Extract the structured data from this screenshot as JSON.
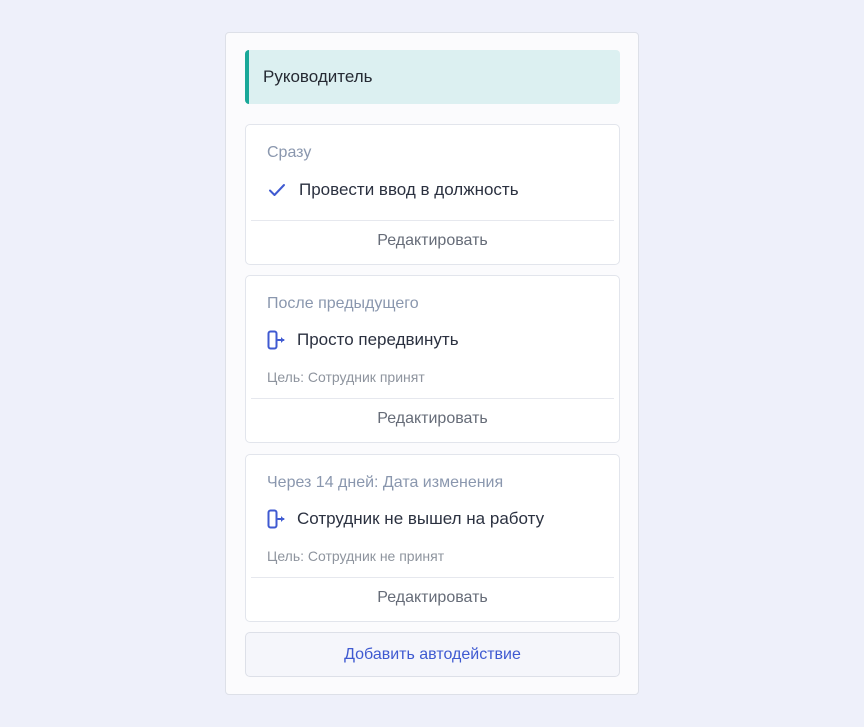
{
  "header": {
    "title": "Руководитель"
  },
  "cards": [
    {
      "trigger": "Сразу",
      "action_label": "Провести ввод в должность",
      "action_icon": "check-icon",
      "goal": "",
      "edit_label": "Редактировать"
    },
    {
      "trigger": "После предыдущего",
      "action_label": "Просто передвинуть",
      "action_icon": "move-to-stage-icon",
      "goal": "Цель: Сотрудник принят",
      "edit_label": "Редактировать"
    },
    {
      "trigger": "Через 14 дней: Дата изменения",
      "action_label": "Сотрудник не вышел на работу",
      "action_icon": "move-to-stage-icon",
      "goal": "Цель: Сотрудник не принят",
      "edit_label": "Редактировать"
    }
  ],
  "add_button": {
    "label": "Добавить автодействие"
  },
  "colors": {
    "accent": "#19a899",
    "header_bg": "#dcf0f1",
    "icon_blue": "#3f5ad1",
    "link_blue": "#3f5ad1"
  }
}
